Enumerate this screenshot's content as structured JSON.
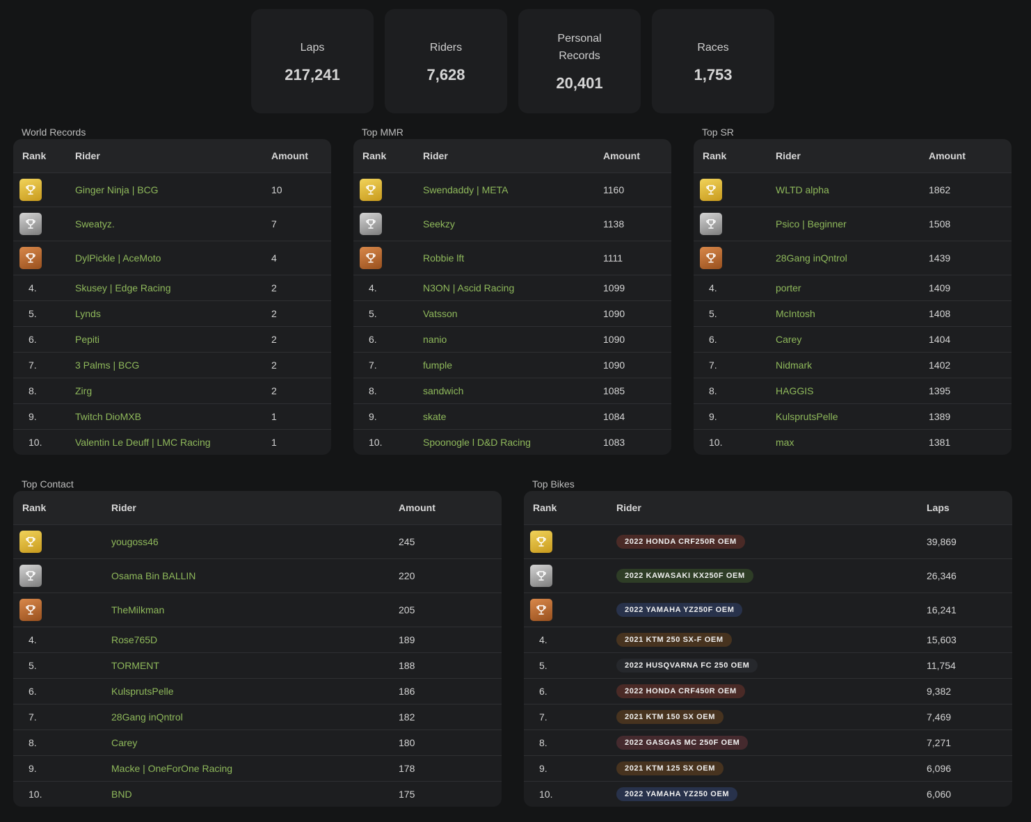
{
  "stats": [
    {
      "label": "Laps",
      "value": "217,241"
    },
    {
      "label": "Riders",
      "value": "7,628"
    },
    {
      "label": "Personal Records",
      "value": "20,401"
    },
    {
      "label": "Races",
      "value": "1,753"
    }
  ],
  "boards": {
    "world_records": {
      "title": "World Records",
      "headers": [
        "Rank",
        "Rider",
        "Amount"
      ],
      "rows": [
        {
          "rank": "1.",
          "rider": "Ginger Ninja | BCG",
          "amount": "10"
        },
        {
          "rank": "2.",
          "rider": "Sweatyz.",
          "amount": "7"
        },
        {
          "rank": "3.",
          "rider": "DylPickle | AceMoto",
          "amount": "4"
        },
        {
          "rank": "4.",
          "rider": "Skusey | Edge Racing",
          "amount": "2"
        },
        {
          "rank": "5.",
          "rider": "Lynds",
          "amount": "2"
        },
        {
          "rank": "6.",
          "rider": "Pepiti",
          "amount": "2"
        },
        {
          "rank": "7.",
          "rider": "3 Palms | BCG",
          "amount": "2"
        },
        {
          "rank": "8.",
          "rider": "Zirg",
          "amount": "2"
        },
        {
          "rank": "9.",
          "rider": "Twitch DioMXB",
          "amount": "1"
        },
        {
          "rank": "10.",
          "rider": "Valentin Le Deuff | LMC Racing",
          "amount": "1"
        }
      ]
    },
    "top_mmr": {
      "title": "Top MMR",
      "headers": [
        "Rank",
        "Rider",
        "Amount"
      ],
      "rows": [
        {
          "rank": "1.",
          "rider": "Swendaddy | META",
          "amount": "1160"
        },
        {
          "rank": "2.",
          "rider": "Seekzy",
          "amount": "1138"
        },
        {
          "rank": "3.",
          "rider": "Robbie lft",
          "amount": "1111"
        },
        {
          "rank": "4.",
          "rider": "N3ON | Ascid Racing",
          "amount": "1099"
        },
        {
          "rank": "5.",
          "rider": "Vatsson",
          "amount": "1090"
        },
        {
          "rank": "6.",
          "rider": "nanio",
          "amount": "1090"
        },
        {
          "rank": "7.",
          "rider": "fumple",
          "amount": "1090"
        },
        {
          "rank": "8.",
          "rider": "sandwich",
          "amount": "1085"
        },
        {
          "rank": "9.",
          "rider": "skate",
          "amount": "1084"
        },
        {
          "rank": "10.",
          "rider": "Spoonogle l D&D Racing",
          "amount": "1083"
        }
      ]
    },
    "top_sr": {
      "title": "Top SR",
      "headers": [
        "Rank",
        "Rider",
        "Amount"
      ],
      "rows": [
        {
          "rank": "1.",
          "rider": "WLTD alpha",
          "amount": "1862"
        },
        {
          "rank": "2.",
          "rider": "Psico | Beginner",
          "amount": "1508"
        },
        {
          "rank": "3.",
          "rider": "28Gang inQntrol",
          "amount": "1439"
        },
        {
          "rank": "4.",
          "rider": "porter",
          "amount": "1409"
        },
        {
          "rank": "5.",
          "rider": "McIntosh",
          "amount": "1408"
        },
        {
          "rank": "6.",
          "rider": "Carey",
          "amount": "1404"
        },
        {
          "rank": "7.",
          "rider": "Nidmark",
          "amount": "1402"
        },
        {
          "rank": "8.",
          "rider": "HAGGIS",
          "amount": "1395"
        },
        {
          "rank": "9.",
          "rider": "KulsprutsPelle",
          "amount": "1389"
        },
        {
          "rank": "10.",
          "rider": "max",
          "amount": "1381"
        }
      ]
    },
    "top_contact": {
      "title": "Top Contact",
      "headers": [
        "Rank",
        "Rider",
        "Amount"
      ],
      "rows": [
        {
          "rank": "1.",
          "rider": "yougoss46",
          "amount": "245"
        },
        {
          "rank": "2.",
          "rider": "Osama Bin BALLIN",
          "amount": "220"
        },
        {
          "rank": "3.",
          "rider": "TheMilkman",
          "amount": "205"
        },
        {
          "rank": "4.",
          "rider": "Rose765D",
          "amount": "189"
        },
        {
          "rank": "5.",
          "rider": "TORMENT",
          "amount": "188"
        },
        {
          "rank": "6.",
          "rider": "KulsprutsPelle",
          "amount": "186"
        },
        {
          "rank": "7.",
          "rider": "28Gang inQntrol",
          "amount": "182"
        },
        {
          "rank": "8.",
          "rider": "Carey",
          "amount": "180"
        },
        {
          "rank": "9.",
          "rider": "Macke | OneForOne Racing",
          "amount": "178"
        },
        {
          "rank": "10.",
          "rider": "BND",
          "amount": "175"
        }
      ]
    },
    "top_bikes": {
      "title": "Top Bikes",
      "headers": [
        "Rank",
        "Rider",
        "Laps"
      ],
      "rows": [
        {
          "rank": "1.",
          "bike": "2022 HONDA CRF250R OEM",
          "amount": "39,869",
          "color": "#4a2a26"
        },
        {
          "rank": "2.",
          "bike": "2022 KAWASAKI KX250F OEM",
          "amount": "26,346",
          "color": "#2e3d26"
        },
        {
          "rank": "3.",
          "bike": "2022 YAMAHA YZ250F OEM",
          "amount": "16,241",
          "color": "#28324b"
        },
        {
          "rank": "4.",
          "bike": "2021 KTM 250 SX-F OEM",
          "amount": "15,603",
          "color": "#47331f"
        },
        {
          "rank": "5.",
          "bike": "2022 HUSQVARNA FC 250 OEM",
          "amount": "11,754",
          "color": "#26282c"
        },
        {
          "rank": "6.",
          "bike": "2022 HONDA CRF450R OEM",
          "amount": "9,382",
          "color": "#4a2a26"
        },
        {
          "rank": "7.",
          "bike": "2021 KTM 150 SX OEM",
          "amount": "7,469",
          "color": "#47331f"
        },
        {
          "rank": "8.",
          "bike": "2022 GASGAS MC 250F OEM",
          "amount": "7,271",
          "color": "#452a2e"
        },
        {
          "rank": "9.",
          "bike": "2021 KTM 125 SX OEM",
          "amount": "6,096",
          "color": "#47331f"
        },
        {
          "rank": "10.",
          "bike": "2022 YAMAHA YZ250 OEM",
          "amount": "6,060",
          "color": "#28324b"
        }
      ]
    }
  },
  "medal_colors": {
    "gold": "#e2b83a",
    "silver": "#a8a8a8",
    "bronze": "#b86a33"
  },
  "accent_rider_color": "#8fb95b"
}
